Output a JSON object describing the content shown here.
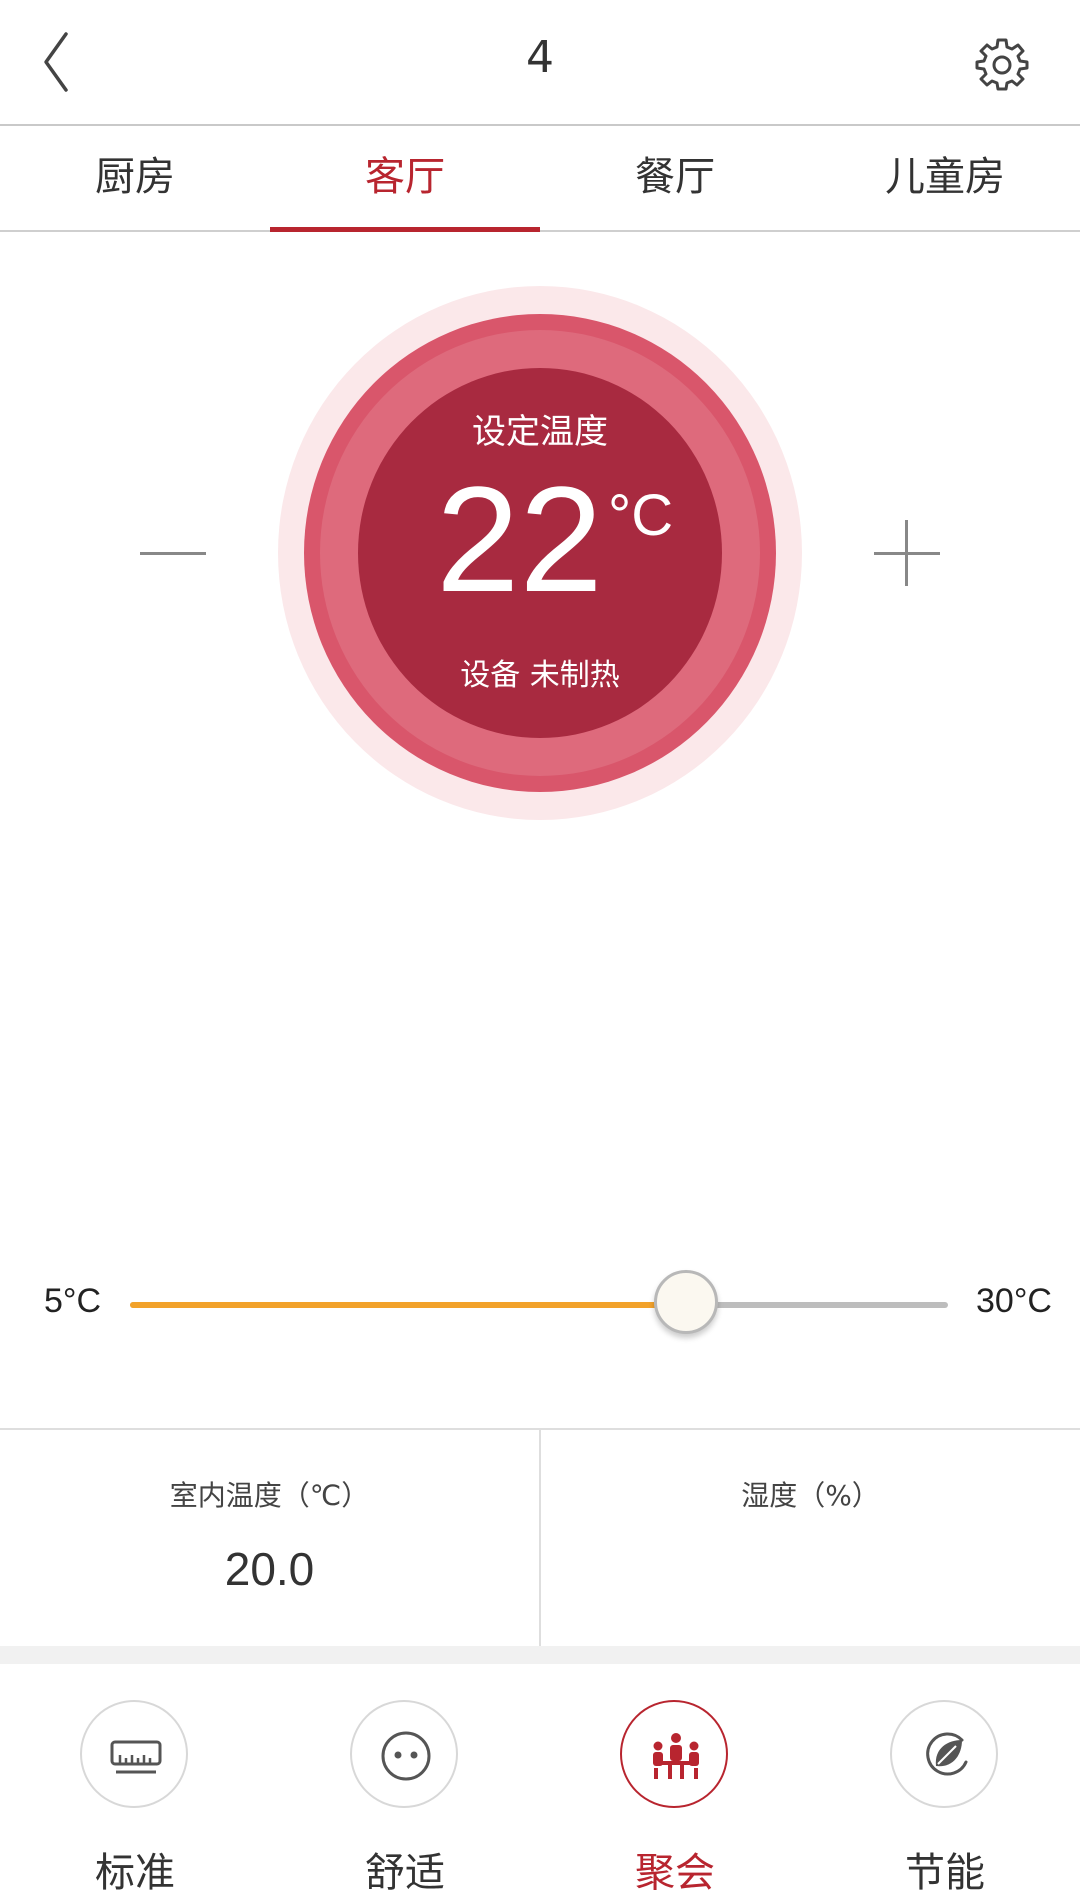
{
  "header": {
    "title": "4",
    "back_icon": "chevron-left-icon",
    "settings_icon": "gear-icon"
  },
  "tabs": [
    {
      "label": "厨房",
      "active": false
    },
    {
      "label": "客厅",
      "active": true
    },
    {
      "label": "餐厅",
      "active": false
    },
    {
      "label": "儿童房",
      "active": false
    }
  ],
  "dial": {
    "label": "设定温度",
    "value": "22",
    "unit": "°C",
    "status": "设备 未制热"
  },
  "slider": {
    "min_label": "5°C",
    "max_label": "30°C",
    "min": 5,
    "max": 30,
    "value": 22
  },
  "readings": [
    {
      "label": "室内温度（℃）",
      "value": "20.0"
    },
    {
      "label": "湿度（%）",
      "value": ""
    }
  ],
  "modes": [
    {
      "label": "标准",
      "icon": "ruler-icon",
      "active": false
    },
    {
      "label": "舒适",
      "icon": "smiley-icon",
      "active": false
    },
    {
      "label": "聚会",
      "icon": "party-people-icon",
      "active": true
    },
    {
      "label": "节能",
      "icon": "leaf-icon",
      "active": false
    }
  ],
  "colors": {
    "accent": "#b8252f",
    "dial_inner": "#a82a40",
    "dial_ring": "#d9566b",
    "slider_fill": "#f2a22a"
  }
}
